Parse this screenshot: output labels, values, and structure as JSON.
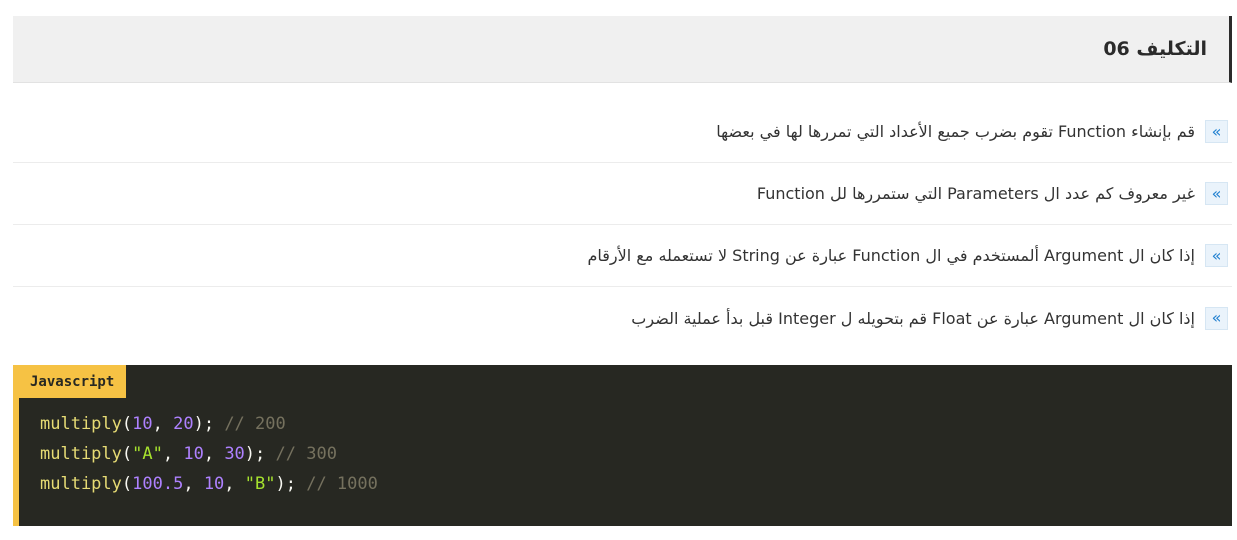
{
  "header": {
    "title": "التكليف 06"
  },
  "tasks": [
    {
      "bullet_icon": "double-chevron-right-icon",
      "text": "قم بإنشاء Function تقوم بضرب جميع الأعداد التي تمررها لها في بعضها"
    },
    {
      "bullet_icon": "double-chevron-right-icon",
      "text": "غير معروف كم عدد ال Parameters التي ستمررها لل Function"
    },
    {
      "bullet_icon": "double-chevron-right-icon",
      "text": "إذا كان ال Argument ألمستخدم في ال Function عبارة عن String لا تستعمله مع الأرقام"
    },
    {
      "bullet_icon": "double-chevron-right-icon",
      "text": "إذا كان ال Argument عبارة عن Float قم بتحويله ل Integer قبل بدأ عملية الضرب"
    }
  ],
  "code": {
    "language": "Javascript",
    "lines": [
      [
        {
          "t": "multiply",
          "k": "fn"
        },
        {
          "t": "(",
          "k": "pn"
        },
        {
          "t": "10",
          "k": "num"
        },
        {
          "t": ", ",
          "k": "pn"
        },
        {
          "t": "20",
          "k": "num"
        },
        {
          "t": "); ",
          "k": "pn"
        },
        {
          "t": "// 200",
          "k": "cm"
        }
      ],
      [
        {
          "t": "multiply",
          "k": "fn"
        },
        {
          "t": "(",
          "k": "pn"
        },
        {
          "t": "\"A\"",
          "k": "str"
        },
        {
          "t": ", ",
          "k": "pn"
        },
        {
          "t": "10",
          "k": "num"
        },
        {
          "t": ", ",
          "k": "pn"
        },
        {
          "t": "30",
          "k": "num"
        },
        {
          "t": "); ",
          "k": "pn"
        },
        {
          "t": "// 300",
          "k": "cm"
        }
      ],
      [
        {
          "t": "multiply",
          "k": "fn"
        },
        {
          "t": "(",
          "k": "pn"
        },
        {
          "t": "100.5",
          "k": "num"
        },
        {
          "t": ", ",
          "k": "pn"
        },
        {
          "t": "10",
          "k": "num"
        },
        {
          "t": ", ",
          "k": "pn"
        },
        {
          "t": "\"B\"",
          "k": "str"
        },
        {
          "t": "); ",
          "k": "pn"
        },
        {
          "t": "// 1000",
          "k": "cm"
        }
      ]
    ]
  },
  "colors": {
    "accent": "#f6c244",
    "code_background": "#272822",
    "bullet": "#1e7fd0"
  }
}
